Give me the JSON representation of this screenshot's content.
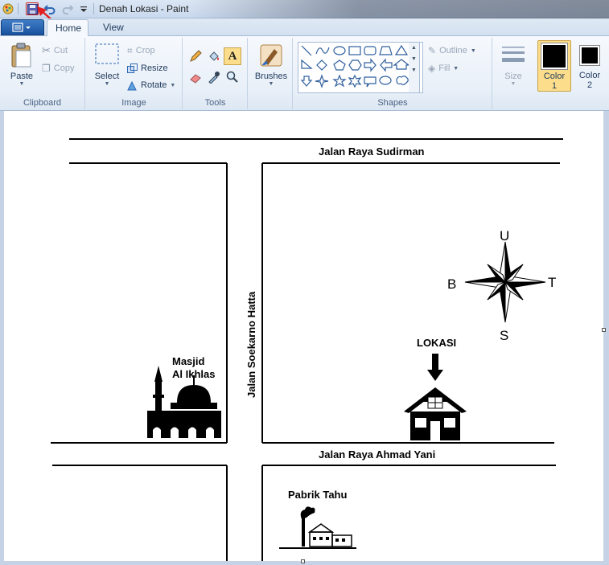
{
  "window": {
    "title": "Denah Lokasi - Paint"
  },
  "tabs": {
    "home": "Home",
    "view": "View"
  },
  "ribbon": {
    "clipboard": {
      "label": "Clipboard",
      "paste": "Paste",
      "cut": "Cut",
      "copy": "Copy"
    },
    "image": {
      "label": "Image",
      "select": "Select",
      "crop": "Crop",
      "resize": "Resize",
      "rotate": "Rotate"
    },
    "tools": {
      "label": "Tools"
    },
    "brushes": {
      "label": "Brushes"
    },
    "shapes": {
      "label": "Shapes",
      "outline": "Outline",
      "fill": "Fill"
    },
    "size": {
      "label": "Size"
    },
    "color1": {
      "label_line1": "Color",
      "label_line2": "1",
      "value": "#000000"
    },
    "color2": {
      "label_line1": "Color",
      "label_line2": "2",
      "value": "#000000"
    }
  },
  "map": {
    "road_top": "Jalan Raya Sudirman",
    "road_vertical": "Jalan Soekarno Hatta",
    "road_middle": "Jalan Raya Ahmad Yani",
    "mosque_line1": "Masjid",
    "mosque_line2": "Al Ikhlas",
    "location": "LOKASI",
    "factory": "Pabrik Tahu",
    "compass": {
      "north": "U",
      "south": "S",
      "east": "T",
      "west": "B"
    }
  },
  "colors": {
    "accent": "#19529f",
    "ribbon_bg": "#e9f0f8",
    "canvas_bg": "#c6d3e6",
    "selected_color_bg": "#fbdd8b"
  }
}
